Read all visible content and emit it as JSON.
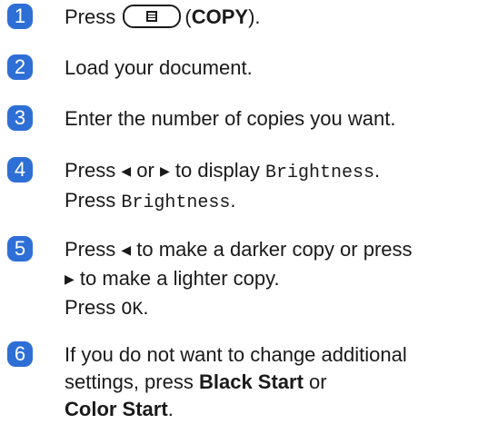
{
  "accent_color": "#2e6fd6",
  "steps": [
    {
      "num": "1",
      "press": "Press",
      "copy_button_icon": "copy-document-icon",
      "copy_label_open": "(",
      "copy_label": "COPY",
      "copy_label_close": ")."
    },
    {
      "num": "2",
      "text": "Load your document."
    },
    {
      "num": "3",
      "text": "Enter the number of copies you want."
    },
    {
      "num": "4",
      "press": "Press",
      "or": "or",
      "to_display": "to display",
      "brightness": "Brightness",
      "dot": ".",
      "press2": "Press",
      "brightness2": "Brightness",
      "dot2": "."
    },
    {
      "num": "5",
      "press": "Press",
      "line1_rest": "to make a darker copy or press",
      "line2_rest": "to make a lighter copy.",
      "press2": "Press",
      "ok": "OK",
      "dot": "."
    },
    {
      "num": "6",
      "line1": "If you do not want to change additional",
      "line2_pre": "settings, press",
      "black_start": "Black Start",
      "or": "or",
      "color_start": "Color Start",
      "dot": "."
    }
  ]
}
